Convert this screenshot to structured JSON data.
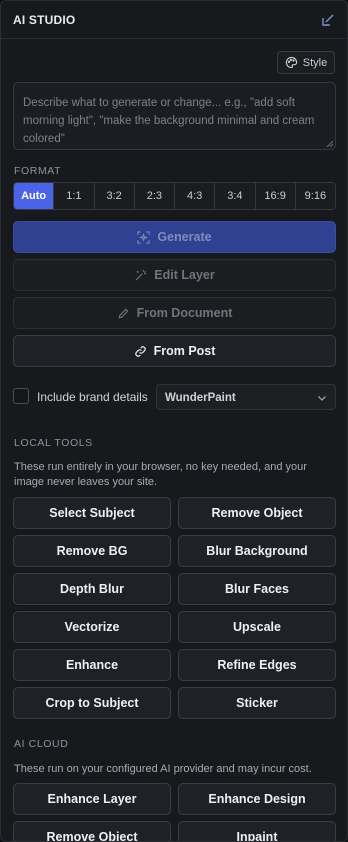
{
  "header": {
    "title": "AI STUDIO",
    "collapse_icon": "collapse-arrow-icon"
  },
  "style_button": {
    "label": "Style",
    "icon": "palette-icon"
  },
  "prompt": {
    "placeholder": "Describe what to generate or change... e.g., \"add soft morning light\", \"make the background minimal and cream colored\"",
    "value": ""
  },
  "format": {
    "label": "FORMAT",
    "ratios": [
      "Auto",
      "1:1",
      "3:2",
      "2:3",
      "4:3",
      "3:4",
      "16:9",
      "9:16"
    ],
    "selected": "Auto"
  },
  "actions": {
    "generate": {
      "label": "Generate",
      "icon": "sparkle-scan-icon",
      "state": "disabled"
    },
    "edit_layer": {
      "label": "Edit Layer",
      "icon": "magic-wand-icon",
      "state": "disabled"
    },
    "from_document": {
      "label": "From Document",
      "icon": "pencil-icon",
      "state": "disabled"
    },
    "from_post": {
      "label": "From Post",
      "icon": "link-icon",
      "state": "enabled"
    }
  },
  "brand": {
    "checkbox_label": "Include brand details",
    "checked": false,
    "selected_brand": "WunderPaint"
  },
  "local_tools": {
    "label": "LOCAL TOOLS",
    "description": "These run entirely in your browser, no key needed, and your image never leaves your site.",
    "buttons": [
      "Select Subject",
      "Remove Object",
      "Remove BG",
      "Blur Background",
      "Depth Blur",
      "Blur Faces",
      "Vectorize",
      "Upscale",
      "Enhance",
      "Refine Edges",
      "Crop to Subject",
      "Sticker"
    ]
  },
  "ai_cloud": {
    "label": "AI CLOUD",
    "description": "These run on your configured AI provider and may incur cost.",
    "buttons": [
      "Enhance Layer",
      "Enhance Design",
      "Remove Object",
      "Inpaint"
    ]
  },
  "colors": {
    "accent": "#4a63e7",
    "panel_bg": "#17191d",
    "button_bg": "#1f2126",
    "generate_bg": "#2f4190"
  }
}
